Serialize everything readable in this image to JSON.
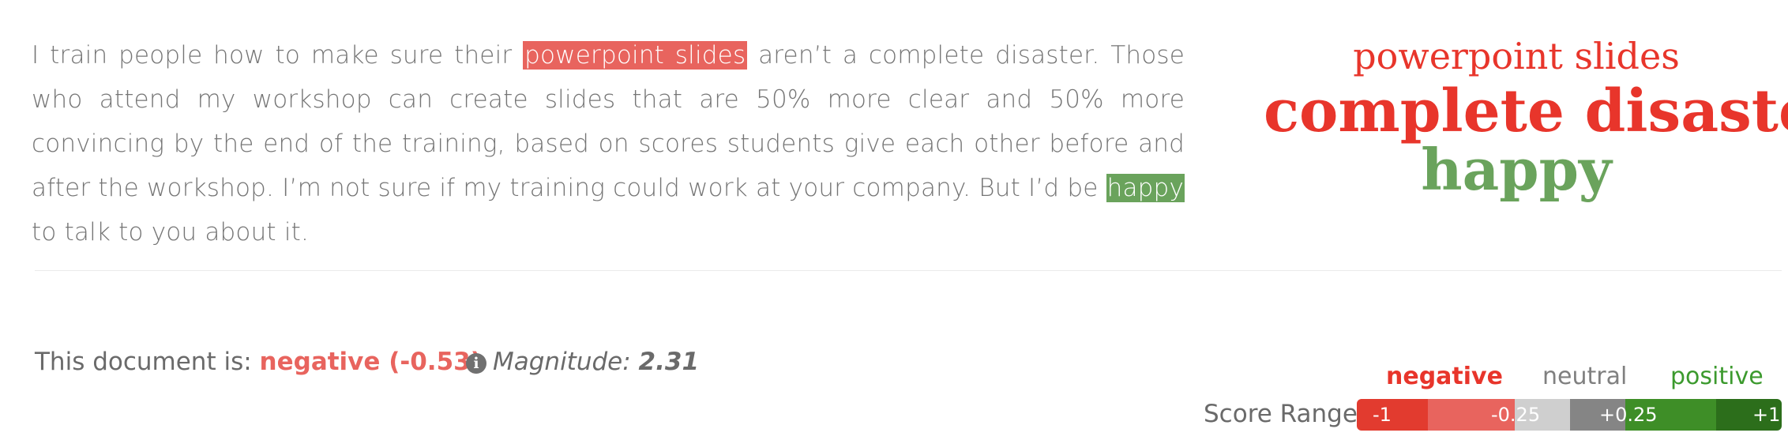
{
  "text": {
    "seg1": "I train people how to make sure their ",
    "hl_neg": "powerpoint slides",
    "seg2": " aren’t a complete disaster. Those who attend my workshop can create slides that are 50% more clear and 50% more convincing by the end of the training, based on scores students give each other before and after the workshop. I’m not sure if my training could work at your company. But I’d be ",
    "hl_pos": "happy",
    "seg3": " to talk to you about it."
  },
  "word_cloud": [
    {
      "text": "powerpoint slides",
      "sentiment": "negative"
    },
    {
      "text": "complete disaster",
      "sentiment": "negative"
    },
    {
      "text": "happy",
      "sentiment": "positive"
    }
  ],
  "summary": {
    "prefix": "This document is: ",
    "sentiment_label": "negative (-0.53)",
    "magnitude_label": "Magnitude: ",
    "magnitude_value": "2.31",
    "info_icon": "info-circle-icon"
  },
  "score_range": {
    "label": "Score Range",
    "categories": {
      "negative": "negative",
      "neutral": "neutral",
      "positive": "positive"
    },
    "ticks": [
      "-1",
      "-0.25",
      "+0.25",
      "+1"
    ]
  },
  "colors": {
    "negative": "#e8352b",
    "negative_highlight": "#e8645e",
    "positive_highlight": "#6aa35c",
    "positive_label": "#3c9a2e",
    "neutral": "#808080"
  }
}
